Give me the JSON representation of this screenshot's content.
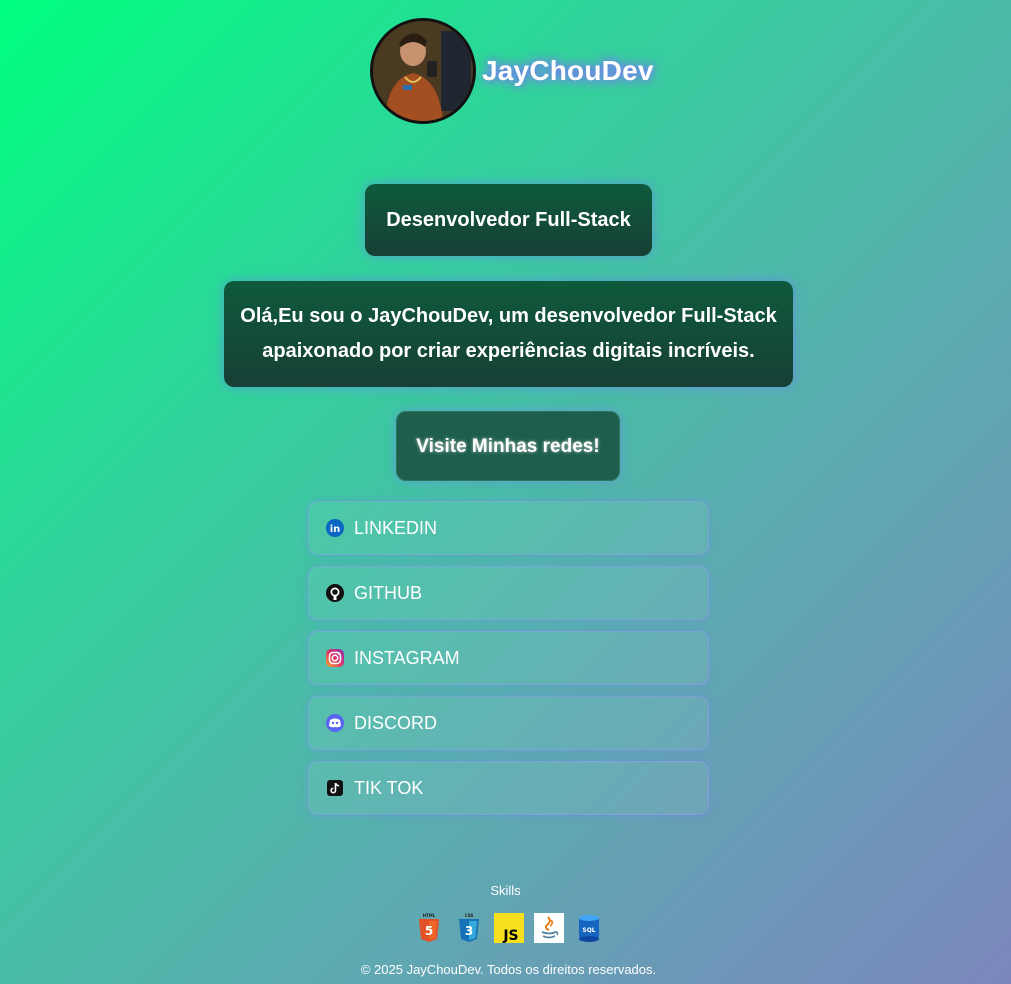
{
  "header": {
    "brand": "JayChouDev"
  },
  "role": "Desenvolvedor Full-Stack",
  "intro": {
    "line1": "Olá,Eu sou o JayChouDev, um desenvolvedor Full-Stack",
    "line2": "apaixonado por criar experiências digitais incríveis."
  },
  "cta": "Visite Minhas redes!",
  "links": [
    {
      "label": "LINKEDIN",
      "icon": "linkedin-icon"
    },
    {
      "label": "GITHUB",
      "icon": "github-icon"
    },
    {
      "label": "INSTAGRAM",
      "icon": "instagram-icon"
    },
    {
      "label": "DISCORD",
      "icon": "discord-icon"
    },
    {
      "label": "TIK TOK",
      "icon": "tiktok-icon"
    }
  ],
  "skills": {
    "title": "Skills",
    "items": [
      {
        "name": "html5-icon",
        "text": "HTML"
      },
      {
        "name": "css3-icon",
        "text": "CSS"
      },
      {
        "name": "javascript-icon",
        "text": "JS"
      },
      {
        "name": "java-icon",
        "text": ""
      },
      {
        "name": "sql-icon",
        "text": "SQL"
      }
    ]
  },
  "footer": "© 2025 JayChouDev. Todos os direitos reservados.",
  "colors": {
    "gradient_start": "#00ff7f",
    "gradient_end": "#7b86bd",
    "card_bg": "#0e5a3c",
    "glow": "#7b6cff"
  }
}
